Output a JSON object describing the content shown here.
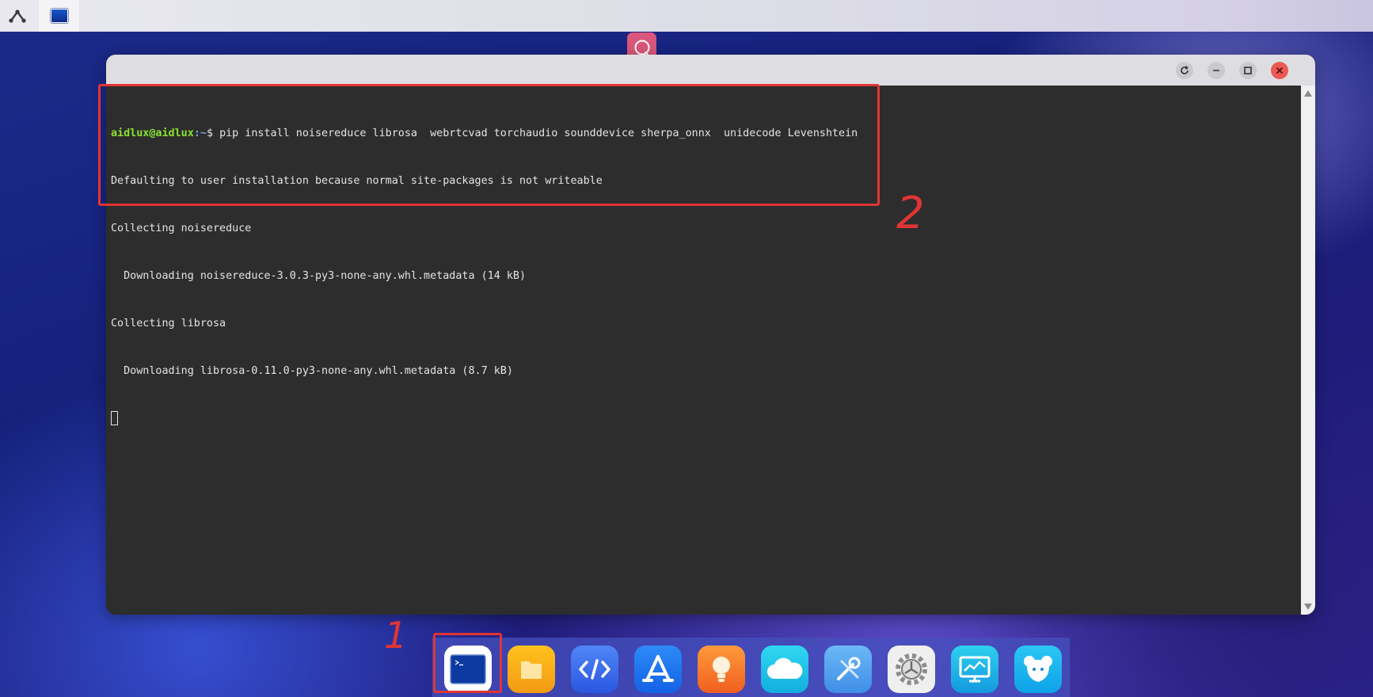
{
  "topbar": {
    "logo_icon": "aidlux-logo-icon",
    "active_tab_icon": "terminal-icon"
  },
  "search": {
    "icon": "search-icon",
    "color": "#d9577a"
  },
  "window": {
    "controls": [
      "refresh-icon",
      "minimize-icon",
      "maximize-icon",
      "close-icon"
    ],
    "terminal": {
      "prompt_user": "aidlux@aidlux",
      "prompt_path": ":~",
      "prompt_symbol": "$ ",
      "command": "pip install noisereduce librosa  webrtcvad torchaudio sounddevice sherpa_onnx  unidecode Levenshtein",
      "output": [
        "Defaulting to user installation because normal site-packages is not writeable",
        "Collecting noisereduce",
        "  Downloading noisereduce-3.0.3-py3-none-any.whl.metadata (14 kB)",
        "Collecting librosa",
        "  Downloading librosa-0.11.0-py3-none-any.whl.metadata (8.7 kB)"
      ]
    }
  },
  "annotations": {
    "label_1": "1",
    "label_2": "2",
    "color": "#e03535"
  },
  "dock": {
    "items": [
      {
        "name": "terminal-app",
        "icon": "terminal-icon",
        "color": "#ffffff"
      },
      {
        "name": "files-app",
        "icon": "folder-icon",
        "color": "#f7a81b"
      },
      {
        "name": "code-app",
        "icon": "code-icon",
        "color": "#3a6df0"
      },
      {
        "name": "app-store-app",
        "icon": "app-store-icon",
        "color": "#1f74f0"
      },
      {
        "name": "ideas-app",
        "icon": "lightbulb-icon",
        "color": "#f27a2a"
      },
      {
        "name": "cloud-app",
        "icon": "cloud-icon",
        "color": "#1fc6e8"
      },
      {
        "name": "tools-app",
        "icon": "tools-icon",
        "color": "#5aaaf0"
      },
      {
        "name": "settings-app",
        "icon": "gear-icon",
        "color": "#ececec"
      },
      {
        "name": "monitor-app",
        "icon": "monitor-chart-icon",
        "color": "#19b6e8"
      },
      {
        "name": "mascot-app",
        "icon": "mascot-icon",
        "color": "#1ab4ea"
      }
    ]
  }
}
